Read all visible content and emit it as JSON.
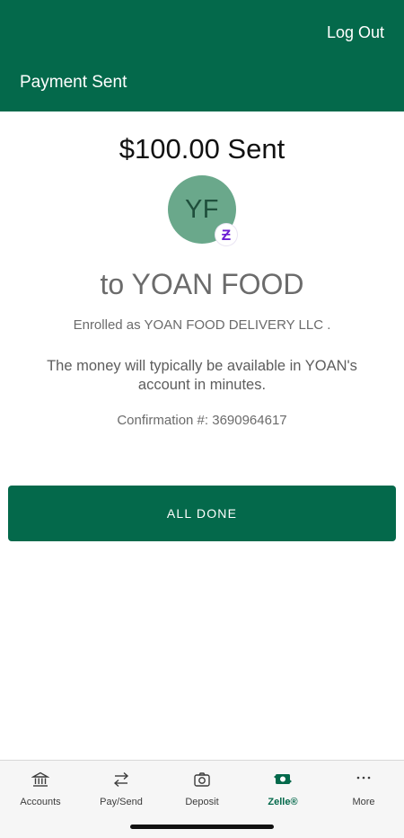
{
  "header": {
    "logout_label": "Log Out",
    "title": "Payment Sent"
  },
  "payment": {
    "amount_text": "$100.00 Sent",
    "avatar_initials": "YF",
    "recipient_text": "to YOAN FOOD",
    "enrolled_text": "Enrolled as YOAN FOOD DELIVERY LLC .",
    "availability_text": "The money will typically be available in YOAN's account in minutes.",
    "confirmation_text": "Confirmation #: 3690964617"
  },
  "actions": {
    "done_label": "ALL DONE"
  },
  "tabbar": {
    "active": "Zelle®",
    "items": [
      {
        "label": "Accounts",
        "icon": "bank-icon"
      },
      {
        "label": "Pay/Send",
        "icon": "transfer-arrows-icon"
      },
      {
        "label": "Deposit",
        "icon": "camera-icon"
      },
      {
        "label": "Zelle®",
        "icon": "zelle-money-icon"
      },
      {
        "label": "More",
        "icon": "ellipsis-icon"
      }
    ]
  },
  "colors": {
    "brand_green": "#04694b",
    "avatar_green": "#6aa88b",
    "zelle_purple": "#6d1ed4"
  }
}
